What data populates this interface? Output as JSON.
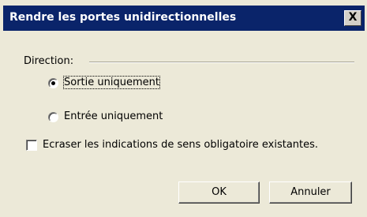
{
  "window": {
    "title": "Rendre les portes unidirectionnelles",
    "close_symbol": "X"
  },
  "direction_group": {
    "label": "Direction:",
    "options": [
      {
        "label": "Sortie uniquement",
        "selected": true
      },
      {
        "label": "Entrée uniquement",
        "selected": false
      }
    ]
  },
  "overwrite_checkbox": {
    "label": "Ecraser les indications de sens obligatoire existantes.",
    "checked": false
  },
  "buttons": {
    "ok_label": "OK",
    "cancel_label": "Annuler"
  },
  "colors": {
    "titlebar": "#0a246a",
    "dialog_background": "#ece9d8"
  }
}
